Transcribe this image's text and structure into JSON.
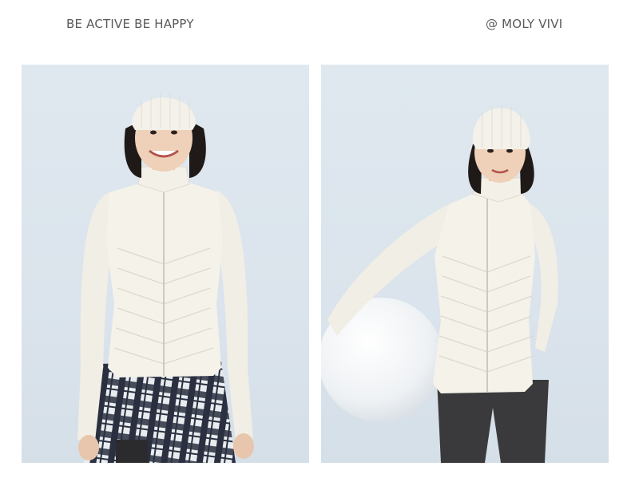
{
  "header": {
    "tagline": "BE ACTIVE BE HAPPY",
    "brand": "@ MOLY VIVI"
  },
  "photos": [
    {
      "subject": "model in cream quilted jacket with knit beanie and plaid skirt"
    },
    {
      "subject": "model in cream quilted jacket with knit beanie holding exercise ball"
    }
  ],
  "colors": {
    "background": "#ffffff",
    "photo_backdrop": "#dfe8ef",
    "jacket": "#f4f1e8",
    "beanie": "#f3f1ea",
    "hair": "#1f1a17",
    "plaid_dark": "#2a3040",
    "leggings": "#3a3a3c",
    "text": "#5a5a5a"
  }
}
